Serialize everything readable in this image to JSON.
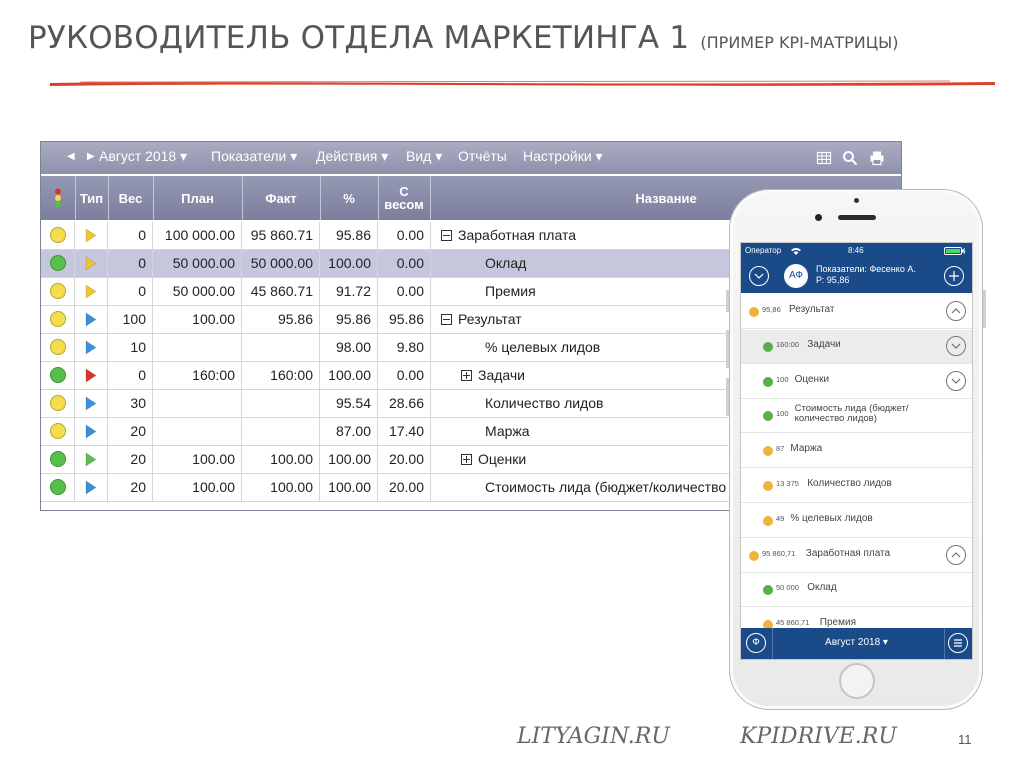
{
  "slide": {
    "title": "РУКОВОДИТЕЛЬ ОТДЕЛА МАРКЕТИНГА 1",
    "subtitle": "(ПРИМЕР KPI-МАТРИЦЫ)",
    "footer_left": "LITYAGIN.RU",
    "footer_right": "KPIDRIVE.RU",
    "page_number": "11"
  },
  "desktop": {
    "toolbar": {
      "period": "Август 2018",
      "menus": [
        "Показатели",
        "Действия",
        "Вид",
        "Отчёты",
        "Настройки"
      ]
    },
    "columns": [
      "Тип",
      "Вес",
      "План",
      "Факт",
      "%",
      "С весом",
      "Название"
    ],
    "rows": [
      {
        "status": "yellow",
        "type": "yellow",
        "weight": "0",
        "plan": "100 000.00",
        "fact": "95 860.71",
        "percent": "95.86",
        "weighted": "0.00",
        "name": "Заработная плата",
        "tree": "minus",
        "level": 0
      },
      {
        "status": "green",
        "type": "yellow",
        "weight": "0",
        "plan": "50 000.00",
        "fact": "50 000.00",
        "percent": "100.00",
        "weighted": "0.00",
        "name": "Оклад",
        "tree": "",
        "level": 1,
        "selected": true
      },
      {
        "status": "yellow",
        "type": "yellow",
        "weight": "0",
        "plan": "50 000.00",
        "fact": "45 860.71",
        "percent": "91.72",
        "weighted": "0.00",
        "name": "Премия",
        "tree": "",
        "level": 1
      },
      {
        "status": "yellow",
        "type": "blue",
        "weight": "100",
        "plan": "100.00",
        "fact": "95.86",
        "percent": "95.86",
        "weighted": "95.86",
        "name": "Результат",
        "tree": "minus",
        "level": 0
      },
      {
        "status": "yellow",
        "type": "blue",
        "weight": "10",
        "plan": "",
        "fact": "",
        "percent": "98.00",
        "weighted": "9.80",
        "name": "% целевых лидов",
        "tree": "",
        "level": 1
      },
      {
        "status": "green",
        "type": "red",
        "weight": "0",
        "plan": "160:00",
        "fact": "160:00",
        "percent": "100.00",
        "weighted": "0.00",
        "name": "Задачи",
        "tree": "plus",
        "level": 1
      },
      {
        "status": "yellow",
        "type": "blue",
        "weight": "30",
        "plan": "",
        "fact": "",
        "percent": "95.54",
        "weighted": "28.66",
        "name": "Количество лидов",
        "tree": "",
        "level": 1
      },
      {
        "status": "yellow",
        "type": "blue",
        "weight": "20",
        "plan": "",
        "fact": "",
        "percent": "87.00",
        "weighted": "17.40",
        "name": "Маржа",
        "tree": "",
        "level": 1
      },
      {
        "status": "green",
        "type": "green",
        "weight": "20",
        "plan": "100.00",
        "fact": "100.00",
        "percent": "100.00",
        "weighted": "20.00",
        "name": "Оценки",
        "tree": "plus",
        "level": 1
      },
      {
        "status": "green",
        "type": "blue",
        "weight": "20",
        "plan": "100.00",
        "fact": "100.00",
        "percent": "100.00",
        "weighted": "20.00",
        "name": "Стоимость лида (бюджет/количество лидов)",
        "tree": "",
        "level": 1
      }
    ]
  },
  "mobile": {
    "status_bar": {
      "carrier": "Оператор",
      "time": "8:46"
    },
    "header": {
      "avatar": "АФ",
      "line1": "Показатели: Фесенко А.",
      "line2": "Р: 95,86"
    },
    "items": [
      {
        "color": "yellow",
        "value": "95,86",
        "label": "Результат",
        "level": 0,
        "chevron": "up"
      },
      {
        "color": "green",
        "value": "160:00",
        "label": "Задачи",
        "level": 1,
        "chevron": "down",
        "highlight": true
      },
      {
        "color": "green",
        "value": "100",
        "label": "Оценки",
        "level": 1,
        "chevron": "down"
      },
      {
        "color": "green",
        "value": "100",
        "label": "Стоимость лида (бюджет/",
        "label2": "количество лидов)",
        "level": 1
      },
      {
        "color": "yellow",
        "value": "87",
        "label": "Маржа",
        "level": 1
      },
      {
        "color": "yellow",
        "value": "13 375",
        "label": "Количество лидов",
        "level": 1
      },
      {
        "color": "yellow",
        "value": "49",
        "label": "% целевых лидов",
        "level": 1
      },
      {
        "color": "yellow",
        "value": "95 860,71",
        "label": "Заработная плата",
        "level": 0,
        "chevron": "up"
      },
      {
        "color": "green",
        "value": "50 000",
        "label": "Оклад",
        "level": 1
      },
      {
        "color": "yellow",
        "value": "45 860,71",
        "label": "Премия",
        "level": 1
      }
    ],
    "footer": {
      "period": "Август 2018",
      "left_button": "Ф"
    }
  },
  "colors": {
    "yellow": "#f3dd4a",
    "green": "#57c04a",
    "red": "#e0342b",
    "blue": "#3c8fd8",
    "flag_yellow": "#f1c232",
    "flag_green": "#59c04f",
    "accent_red": "#d9432e",
    "mobile_navy": "#1b4a89",
    "mobile_yellow": "#f0b33b",
    "mobile_green": "#5cae4c"
  }
}
